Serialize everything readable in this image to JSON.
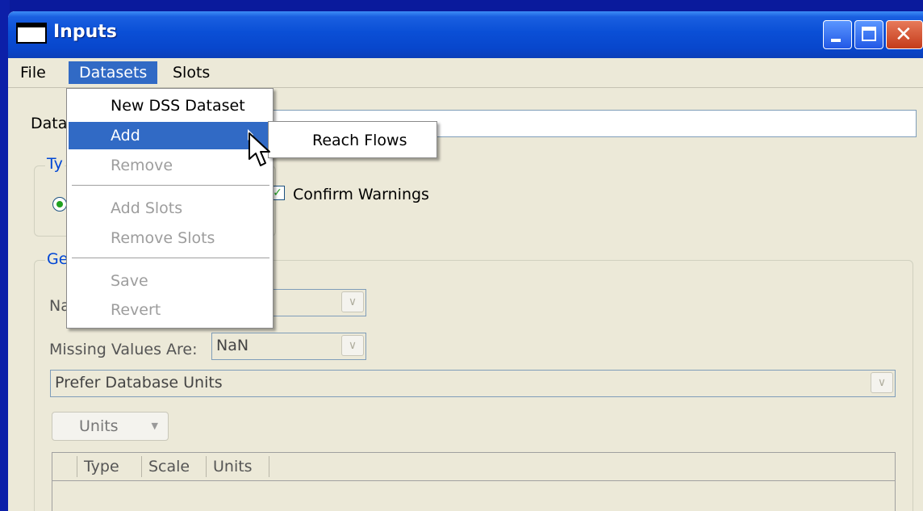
{
  "window": {
    "title": "Inputs"
  },
  "menubar": {
    "file": "File",
    "datasets": "Datasets",
    "slots": "Slots"
  },
  "dropdown": {
    "items": [
      "New DSS Dataset",
      "Add",
      "Remove",
      "Add Slots",
      "Remove Slots",
      "Save",
      "Revert"
    ],
    "submenu": [
      "Reach Flows"
    ]
  },
  "form": {
    "dataset_label_partial": "Data",
    "type_group_partial": "Ty",
    "confirm_warnings": "Confirm Warnings",
    "general_group_partial": "Ge",
    "name_label_partial": "Na",
    "missing_values_label": "Missing Values Are:",
    "missing_values_value": "NaN",
    "units_preference": "Prefer Database Units",
    "units_button": "Units",
    "table_columns": [
      "Type",
      "Scale",
      "Units"
    ]
  },
  "colors": {
    "highlight": "#316ac5",
    "titlebar": "#0846cc",
    "window_bg": "#ece9d8"
  }
}
